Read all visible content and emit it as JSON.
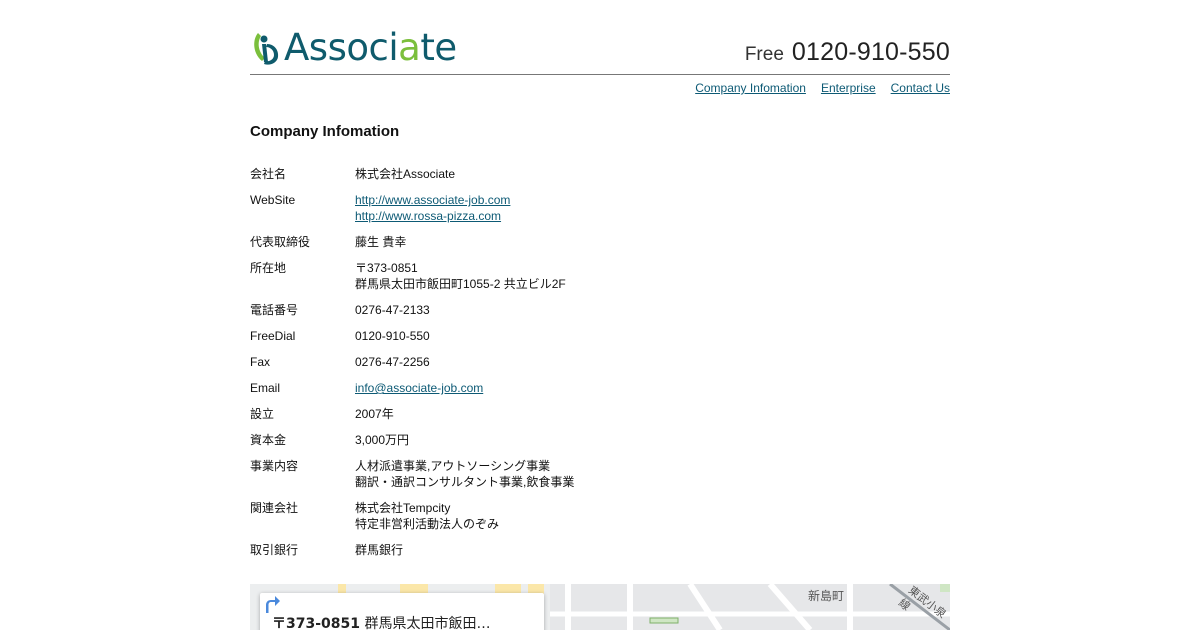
{
  "header": {
    "logo_text_pre": "Associ",
    "logo_text_hl": "a",
    "logo_text_post": "te",
    "phone_label": "Free",
    "phone_number": "0120-910-550"
  },
  "nav": {
    "company": "Company Infomation",
    "enterprise": "Enterprise",
    "contact": "Contact Us"
  },
  "section": {
    "title": "Company Infomation"
  },
  "info": {
    "company_name": {
      "label": "会社名",
      "value": "株式会社Associate"
    },
    "website": {
      "label": "WebSite",
      "links": [
        "http://www.associate-job.com",
        "http://www.rossa-pizza.com"
      ]
    },
    "ceo": {
      "label": "代表取締役",
      "value": "藤生 貴幸"
    },
    "address": {
      "label": "所在地",
      "lines": [
        "〒373-0851",
        "群馬県太田市飯田町1055-2 共立ビル2F"
      ]
    },
    "tel": {
      "label": "電話番号",
      "value": "0276-47-2133"
    },
    "freedial": {
      "label": "FreeDial",
      "value": "0120-910-550"
    },
    "fax": {
      "label": "Fax",
      "value": "0276-47-2256"
    },
    "email": {
      "label": "Email",
      "value": "info@associate-job.com"
    },
    "founded": {
      "label": "設立",
      "value": "2007年"
    },
    "capital": {
      "label": "資本金",
      "value": "3,000万円"
    },
    "business": {
      "label": "事業内容",
      "lines": [
        "人材派遣事業,アウトソーシング事業",
        "翻訳・通訳コンサルタント事業,飲食事業"
      ]
    },
    "related": {
      "label": "関連会社",
      "lines": [
        "株式会社Tempcity",
        "特定非営利活動法人のぞみ"
      ]
    },
    "bank": {
      "label": "取引銀行",
      "value": "群馬銀行"
    }
  },
  "map": {
    "postal": "〒373-0851",
    "address_snippet": "群馬県太田市飯田…",
    "area_label_1": "新島町",
    "area_label_2": "東武小泉線",
    "colors": {
      "road": "#ffffff",
      "land": "#eceeef",
      "yellow": "#fbe7a9",
      "green": "#cfe6c4"
    }
  }
}
